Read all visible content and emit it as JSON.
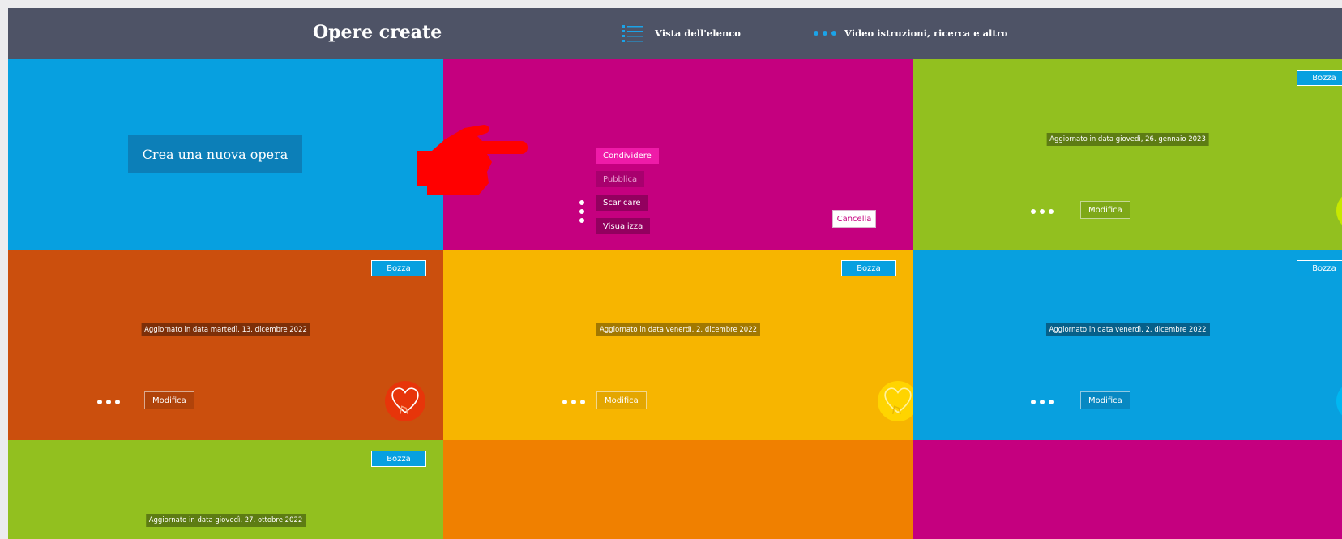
{
  "header": {
    "title": "Opere create",
    "list_view_label": "Vista dell'elenco",
    "more_label": "Video istruzioni, ricerca e altro"
  },
  "create_tile": {
    "button_label": "Crea una nuova opera"
  },
  "open_menu": {
    "items": [
      "Condividere",
      "Pubblica",
      "Scaricare",
      "Visualizza"
    ],
    "cancel_label": "Cancella"
  },
  "works": [
    {
      "status": "Bozza",
      "updated": "Aggiornato in data giovedì, 26. gennaio 2023",
      "edit_label": "Modifica"
    },
    {
      "status": "Bozza",
      "updated": "Aggiornato in data martedì, 13. dicembre 2022",
      "edit_label": "Modifica"
    },
    {
      "status": "Bozza",
      "updated": "Aggiornato in data venerdì, 2. dicembre 2022",
      "edit_label": "Modifica"
    },
    {
      "status": "Bozza",
      "updated": "Aggiornato in data venerdì, 2. dicembre 2022",
      "edit_label": "Modifica"
    },
    {
      "status": "Bozza",
      "updated": "Aggiornato in data giovedì, 27. ottobre 2022"
    }
  ],
  "colors": {
    "header": "#4e5366",
    "blue": "#07a0e0",
    "magenta": "#c5007f",
    "green": "#92c01f",
    "rust": "#cb4f0d",
    "yellow": "#f7b500",
    "orange": "#f08000",
    "pointer_annotation": "#ff0000"
  },
  "icons": [
    "list-view-icon",
    "more-dots-icon",
    "heart-hand-icon",
    "pointing-hand-annotation"
  ]
}
